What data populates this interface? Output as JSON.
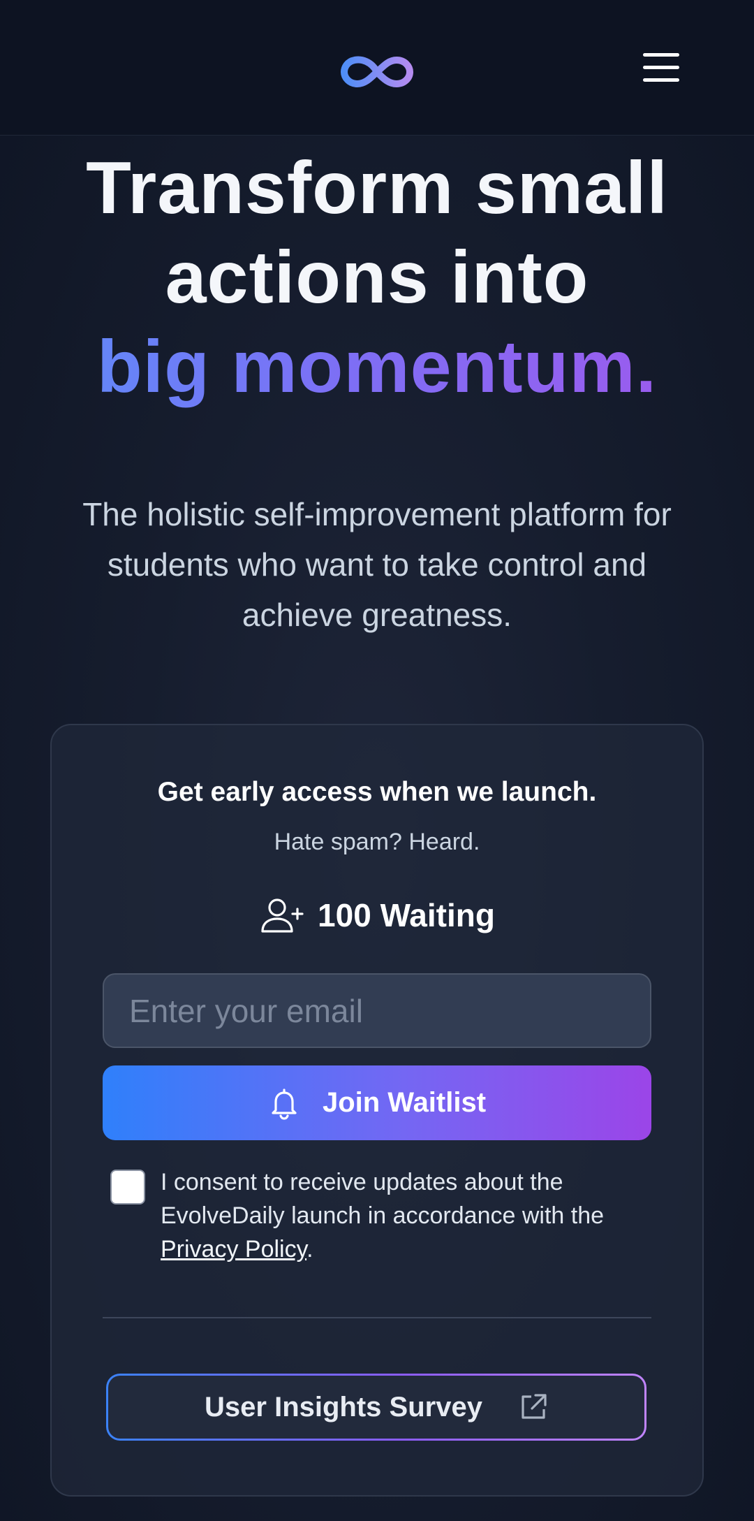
{
  "header": {
    "logo_icon": "infinity-logo-icon",
    "menu_icon": "hamburger-menu-icon"
  },
  "hero": {
    "title_line1": "Transform small",
    "title_line2": "actions into",
    "title_accent": "big momentum.",
    "subtitle": "The holistic self-improvement platform for students who want to take control and achieve greatness."
  },
  "waitlist": {
    "title": "Get early access when we launch.",
    "subtitle": "Hate spam? Heard.",
    "waiting_icon": "user-plus-icon",
    "waiting_count": "100 Waiting",
    "email_placeholder": "Enter your email",
    "email_value": "",
    "join_icon": "bell-icon",
    "join_label": "Join Waitlist",
    "consent_checked": false,
    "consent_text": "I consent to receive updates about the EvolveDaily launch in accordance with the ",
    "consent_link": "Privacy Policy",
    "consent_end": ".",
    "survey_label": "User Insights Survey",
    "survey_icon": "external-link-icon"
  },
  "colors": {
    "background": "#161d2e",
    "header_bg": "#0d1322",
    "accent_blue": "#2f80fb",
    "accent_purple": "#9b45e8"
  }
}
